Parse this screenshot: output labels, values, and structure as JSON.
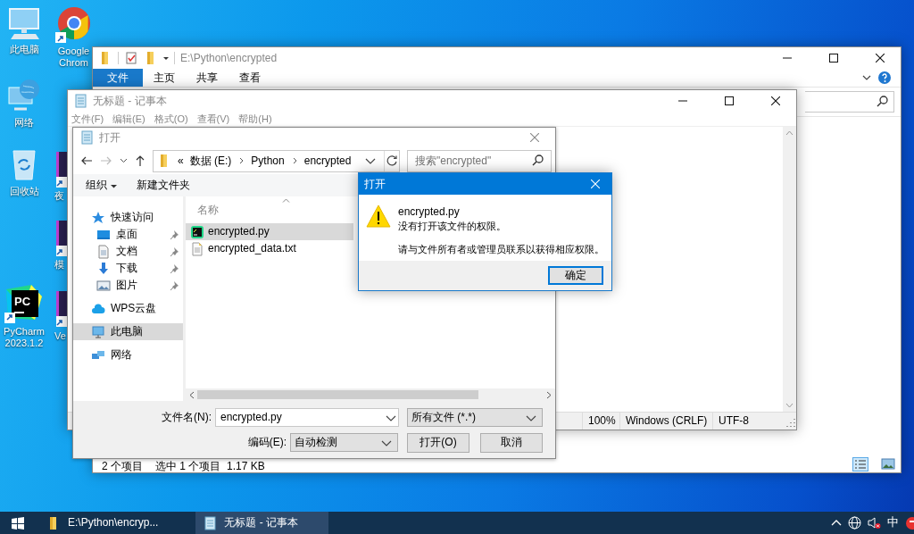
{
  "desktop": {
    "icons": [
      {
        "label": "此电脑",
        "kind": "computer"
      },
      {
        "label": "Google Chrom",
        "kind": "browser"
      },
      {
        "label": "网络",
        "kind": "network"
      },
      {
        "label": "回收站",
        "kind": "recycle"
      },
      {
        "label": "夜",
        "kind": "app"
      },
      {
        "label": "模",
        "kind": "app"
      },
      {
        "label": "PyCharm 2023.1.2",
        "kind": "pycharm",
        "logo_text": "PC"
      },
      {
        "label": "Ve",
        "kind": "app"
      }
    ]
  },
  "explorer": {
    "title": "E:\\Python\\encrypted",
    "ribbon_tabs": [
      {
        "label": "文件",
        "selected": true
      },
      {
        "label": "主页",
        "selected": false
      },
      {
        "label": "共享",
        "selected": false
      },
      {
        "label": "查看",
        "selected": false
      }
    ],
    "status_bar": {
      "item_count": "2 个项目",
      "selection": "选中 1 个项目  1.17 KB"
    }
  },
  "notepad": {
    "title": "无标题 - 记事本",
    "menu": [
      "文件(F)",
      "编辑(E)",
      "格式(O)",
      "查看(V)",
      "帮助(H)"
    ],
    "status_bar": [
      "100%",
      "Windows (CRLF)",
      "UTF-8"
    ]
  },
  "open_dialog": {
    "title": "打开",
    "breadcrumb": {
      "overflow": "«",
      "parts": [
        "数据 (E:)",
        "Python",
        "encrypted"
      ]
    },
    "search": {
      "placeholder": "搜索\"encrypted\""
    },
    "toolbar": [
      "组织",
      "新建文件夹"
    ],
    "nav_pane": [
      {
        "label": "快速访问",
        "selected": false,
        "children": [
          {
            "label": "桌面",
            "selected": false,
            "pinned": true
          },
          {
            "label": "文档",
            "selected": false,
            "pinned": true
          },
          {
            "label": "下载",
            "selected": false,
            "pinned": true
          },
          {
            "label": "图片",
            "selected": false,
            "pinned": true
          }
        ]
      },
      {
        "label": "WPS云盘",
        "selected": false
      },
      {
        "label": "此电脑",
        "selected": true
      },
      {
        "label": "网络",
        "selected": false
      }
    ],
    "columns": [
      "名称"
    ],
    "files": [
      {
        "name": "encrypted.py",
        "kind": "python",
        "selected": true
      },
      {
        "name": "encrypted_data.txt",
        "kind": "text",
        "selected": false
      }
    ],
    "filename_label": "文件名(N):",
    "filename": "encrypted.py",
    "filetype": "所有文件 (*.*)",
    "encoding_label": "编码(E):",
    "encoding": "自动检测",
    "buttons": [
      "打开(O)",
      "取消"
    ]
  },
  "message_box": {
    "title": "打开",
    "file": "encrypted.py",
    "message": "没有打开该文件的权限。",
    "detail": "请与文件所有者或管理员联系以获得相应权限。",
    "button": "确定"
  },
  "taskbar": {
    "buttons": [
      {
        "label": "E:\\Python\\encryp...",
        "kind": "folder",
        "selected": false
      },
      {
        "label": "无标题 - 记事本",
        "kind": "notepad",
        "selected": true
      }
    ],
    "ime": "中"
  }
}
